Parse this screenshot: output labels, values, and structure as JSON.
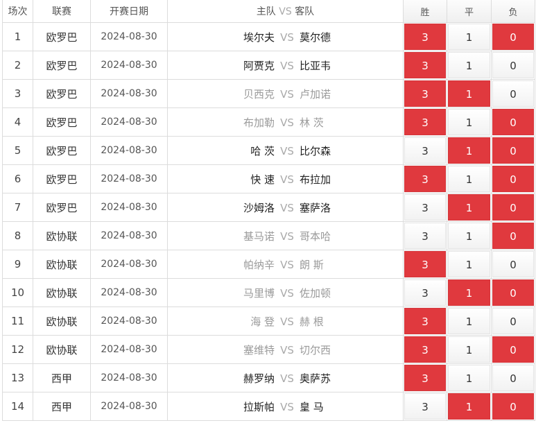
{
  "headers": {
    "index": "场次",
    "league": "联赛",
    "date": "开赛日期",
    "match_home": "主队",
    "match_vs": "VS",
    "match_away": "客队",
    "win": "胜",
    "draw": "平",
    "lose": "负"
  },
  "colors": {
    "selected": "#e0393e",
    "vs": "#a9a9a9"
  },
  "rows": [
    {
      "idx": "1",
      "league": "欧罗巴",
      "date": "2024-08-30",
      "home": "埃尔夫",
      "vs": "VS",
      "away": "莫尔德",
      "home_dark": true,
      "away_dark": true,
      "win": "3",
      "draw": "1",
      "lose": "0",
      "sel": [
        true,
        false,
        true
      ]
    },
    {
      "idx": "2",
      "league": "欧罗巴",
      "date": "2024-08-30",
      "home": "阿贾克",
      "vs": "VS",
      "away": "比亚韦",
      "home_dark": true,
      "away_dark": true,
      "win": "3",
      "draw": "1",
      "lose": "0",
      "sel": [
        true,
        false,
        false
      ]
    },
    {
      "idx": "3",
      "league": "欧罗巴",
      "date": "2024-08-30",
      "home": "贝西克",
      "vs": "VS",
      "away": "卢加诺",
      "home_dark": false,
      "away_dark": false,
      "win": "3",
      "draw": "1",
      "lose": "0",
      "sel": [
        true,
        true,
        false
      ]
    },
    {
      "idx": "4",
      "league": "欧罗巴",
      "date": "2024-08-30",
      "home": "布加勒",
      "vs": "VS",
      "away": "林 茨",
      "home_dark": false,
      "away_dark": false,
      "win": "3",
      "draw": "1",
      "lose": "0",
      "sel": [
        true,
        false,
        true
      ]
    },
    {
      "idx": "5",
      "league": "欧罗巴",
      "date": "2024-08-30",
      "home": "哈 茨",
      "vs": "VS",
      "away": "比尔森",
      "home_dark": true,
      "away_dark": true,
      "win": "3",
      "draw": "1",
      "lose": "0",
      "sel": [
        false,
        true,
        true
      ]
    },
    {
      "idx": "6",
      "league": "欧罗巴",
      "date": "2024-08-30",
      "home": "快 速",
      "vs": "VS",
      "away": "布拉加",
      "home_dark": true,
      "away_dark": true,
      "win": "3",
      "draw": "1",
      "lose": "0",
      "sel": [
        true,
        false,
        true
      ]
    },
    {
      "idx": "7",
      "league": "欧罗巴",
      "date": "2024-08-30",
      "home": "沙姆洛",
      "vs": "VS",
      "away": "塞萨洛",
      "home_dark": true,
      "away_dark": true,
      "win": "3",
      "draw": "1",
      "lose": "0",
      "sel": [
        false,
        true,
        true
      ]
    },
    {
      "idx": "8",
      "league": "欧协联",
      "date": "2024-08-30",
      "home": "基马诺",
      "vs": "VS",
      "away": "哥本哈",
      "home_dark": false,
      "away_dark": false,
      "win": "3",
      "draw": "1",
      "lose": "0",
      "sel": [
        false,
        false,
        true
      ]
    },
    {
      "idx": "9",
      "league": "欧协联",
      "date": "2024-08-30",
      "home": "帕纳辛",
      "vs": "VS",
      "away": "朗 斯",
      "home_dark": false,
      "away_dark": false,
      "win": "3",
      "draw": "1",
      "lose": "0",
      "sel": [
        true,
        false,
        false
      ]
    },
    {
      "idx": "10",
      "league": "欧协联",
      "date": "2024-08-30",
      "home": "马里博",
      "vs": "VS",
      "away": "佐加顿",
      "home_dark": false,
      "away_dark": false,
      "win": "3",
      "draw": "1",
      "lose": "0",
      "sel": [
        false,
        true,
        true
      ]
    },
    {
      "idx": "11",
      "league": "欧协联",
      "date": "2024-08-30",
      "home": "海 登",
      "vs": "VS",
      "away": "赫 根",
      "home_dark": false,
      "away_dark": false,
      "win": "3",
      "draw": "1",
      "lose": "0",
      "sel": [
        true,
        false,
        false
      ]
    },
    {
      "idx": "12",
      "league": "欧协联",
      "date": "2024-08-30",
      "home": "塞维特",
      "vs": "VS",
      "away": "切尔西",
      "home_dark": false,
      "away_dark": false,
      "win": "3",
      "draw": "1",
      "lose": "0",
      "sel": [
        true,
        false,
        true
      ]
    },
    {
      "idx": "13",
      "league": "西甲",
      "date": "2024-08-30",
      "home": "赫罗纳",
      "vs": "VS",
      "away": "奥萨苏",
      "home_dark": true,
      "away_dark": true,
      "win": "3",
      "draw": "1",
      "lose": "0",
      "sel": [
        true,
        false,
        false
      ]
    },
    {
      "idx": "14",
      "league": "西甲",
      "date": "2024-08-30",
      "home": "拉斯帕",
      "vs": "VS",
      "away": "皇 马",
      "home_dark": true,
      "away_dark": true,
      "win": "3",
      "draw": "1",
      "lose": "0",
      "sel": [
        false,
        true,
        true
      ]
    }
  ]
}
